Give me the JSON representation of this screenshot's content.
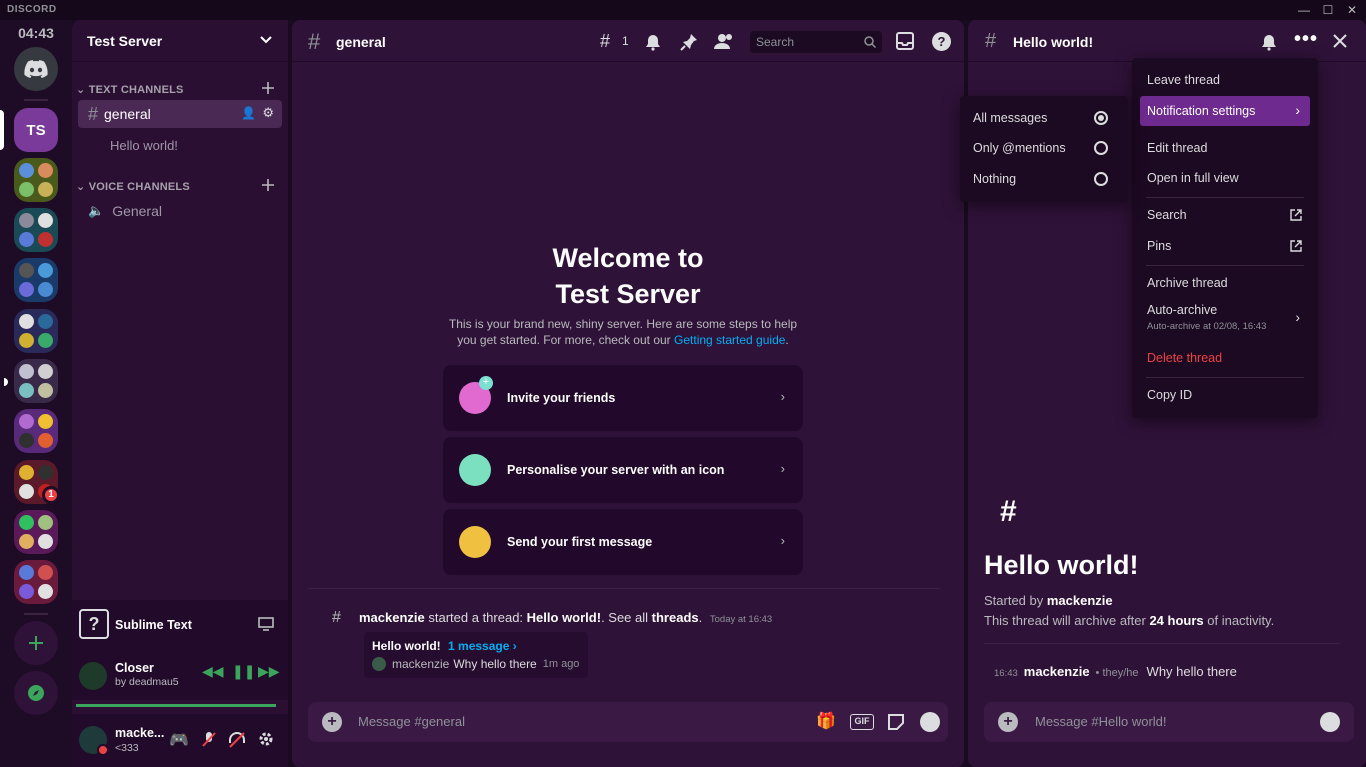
{
  "app": {
    "brand": "DISCORD",
    "clock": "04:43"
  },
  "window": {
    "minimize": "—",
    "maximize": "☐",
    "close": "✕"
  },
  "guilds": {
    "current_initials": "TS",
    "badge_count": "1"
  },
  "server": {
    "name": "Test Server",
    "text_category": "TEXT CHANNELS",
    "voice_category": "VOICE CHANNELS",
    "channels": [
      {
        "name": "general"
      }
    ],
    "thread": "Hello world!",
    "voice_channels": [
      {
        "name": "General"
      }
    ]
  },
  "activity": {
    "name": "Sublime Text"
  },
  "music": {
    "title": "Closer",
    "artist": "by deadmau5"
  },
  "user": {
    "name": "macke...",
    "status": "<333"
  },
  "main": {
    "channel": "general",
    "threads_count": "1",
    "search_placeholder": "Search",
    "welcome_title_1": "Welcome to",
    "welcome_title_2": "Test Server",
    "welcome_text_1": "This is your brand new, shiny server. Here are some steps to help",
    "welcome_text_2": "you get started. For more, check out our ",
    "welcome_link": "Getting started guide",
    "welcome_period": ".",
    "cards": [
      {
        "label": "Invite your friends"
      },
      {
        "label": "Personalise your server with an icon"
      },
      {
        "label": "Send your first message"
      }
    ],
    "sys_user": "mackenzie",
    "sys_text1": " started a thread: ",
    "sys_thread": "Hello world!",
    "sys_text2": ". See all ",
    "sys_threads": "threads",
    "sys_text3": ".",
    "sys_time": "Today at 16:43",
    "preview_title": "Hello world!",
    "preview_count": "1 message ›",
    "preview_user": "mackenzie",
    "preview_msg": "Why hello there",
    "preview_time": "1m ago",
    "input_placeholder": "Message #general"
  },
  "thread": {
    "title": "Hello world!",
    "big_title": "Hello world!",
    "started_by_label": "Started by ",
    "started_by_user": "mackenzie",
    "archive_text_1": "This thread will archive after ",
    "archive_hours": "24 hours",
    "archive_text_2": " of inactivity.",
    "msg_time": "16:43",
    "msg_user": "mackenzie",
    "msg_pronouns": "• they/he",
    "msg_text": "Why hello there",
    "input_placeholder": "Message #Hello world!"
  },
  "menu": {
    "leave": "Leave thread",
    "notif": "Notification settings",
    "edit": "Edit thread",
    "full": "Open in full view",
    "search": "Search",
    "pins": "Pins",
    "archive": "Archive thread",
    "autoarchive": "Auto-archive",
    "autoarchive_sub": "Auto-archive at 02/08, 16:43",
    "delete": "Delete thread",
    "copyid": "Copy ID"
  },
  "submenu": {
    "all": "All messages",
    "mentions": "Only @mentions",
    "nothing": "Nothing",
    "selected": "All messages"
  },
  "colors": {
    "accent": "#7a3a9a",
    "link": "#00aff4",
    "danger": "#ed4245",
    "green": "#3ba55c"
  }
}
